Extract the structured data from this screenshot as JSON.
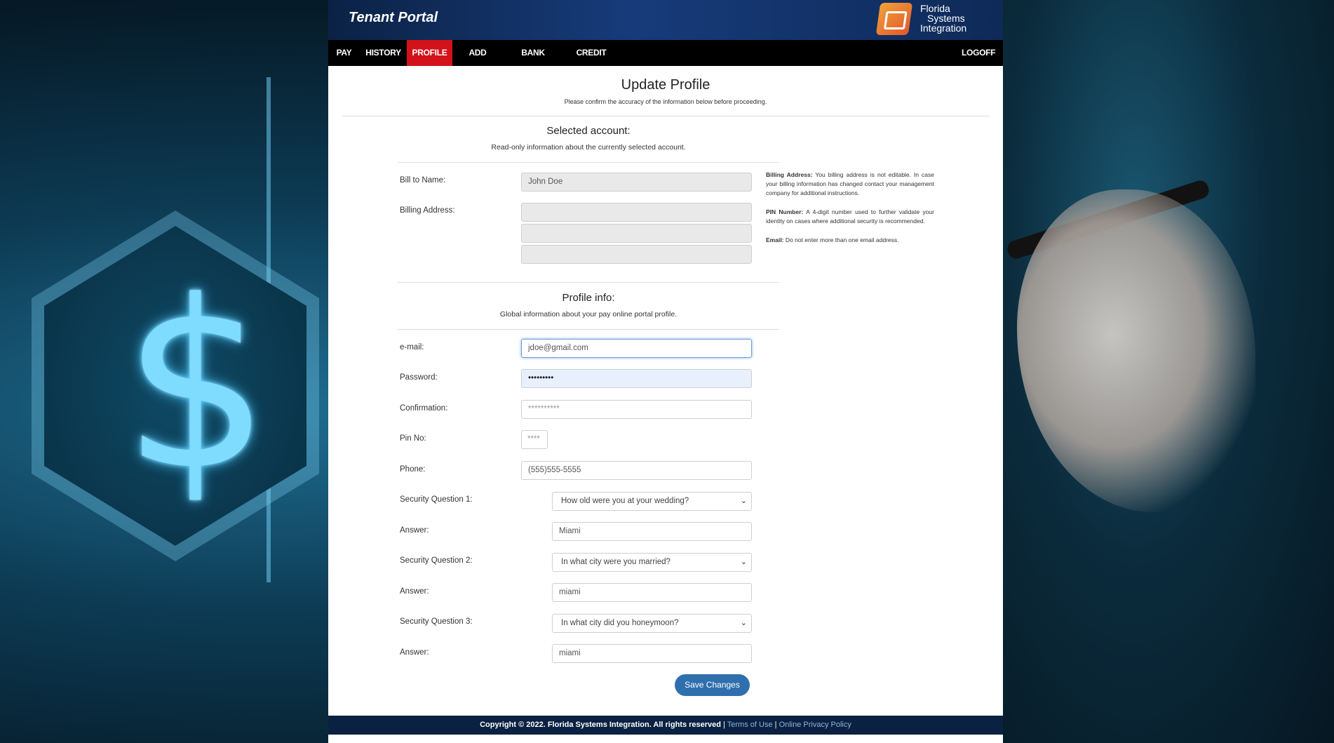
{
  "app": {
    "title": "Tenant Portal"
  },
  "logo": {
    "line1": "Florida",
    "line2": "Systems",
    "line3": "Integration"
  },
  "nav": {
    "items": [
      {
        "label": "PAY",
        "active": false
      },
      {
        "label": "HISTORY",
        "active": false
      },
      {
        "label": "PROFILE",
        "active": true
      },
      {
        "label": "ADD ACCOUNT",
        "active": false
      },
      {
        "label": "BANK ACCOUNTS",
        "active": false
      },
      {
        "label": "CREDIT CARDS",
        "active": false
      }
    ],
    "logoff": "LOGOFF"
  },
  "page": {
    "title": "Update Profile",
    "subtitle": "Please confirm the accuracy of the information below before proceeding."
  },
  "selected_account": {
    "title": "Selected account:",
    "subtitle": "Read-only information about the currently selected account.",
    "bill_to_label": "Bill to Name:",
    "bill_to_value": "John Doe",
    "billing_address_label": "Billing Address:",
    "address_line1": "",
    "address_line2": "",
    "address_line3": ""
  },
  "profile": {
    "title": "Profile info:",
    "subtitle": "Global information about your pay online portal profile.",
    "email_label": "e-mail:",
    "email_value": "jdoe@gmail.com",
    "password_label": "Password:",
    "password_value": "•••••••••",
    "confirmation_label": "Confirmation:",
    "confirmation_placeholder": "**********",
    "pin_label": "Pin No:",
    "pin_placeholder": "****",
    "phone_label": "Phone:",
    "phone_value": "(555)555-5555",
    "sq1_label": "Security Question 1:",
    "sq1_value": "How old were you at your wedding?",
    "answer1_label": "Answer:",
    "answer1_value": "Miami",
    "sq2_label": "Security Question 2:",
    "sq2_value": "In what city were you married?",
    "answer2_label": "Answer:",
    "answer2_value": "miami",
    "sq3_label": "Security Question 3:",
    "sq3_value": "In what city did you honeymoon?",
    "answer3_label": "Answer:",
    "answer3_value": "miami",
    "save_label": "Save Changes"
  },
  "help": {
    "billing_title": "Billing Address:",
    "billing_text": "You billing address is not editable. In case your billing information has changed contact your management company for additional instructions.",
    "pin_title": "PIN Number:",
    "pin_text": "A 4-digit number used to further validate your identity on cases where additional security is recommended.",
    "email_title": "Email:",
    "email_text": "Do not enter more than one email address."
  },
  "footer": {
    "copyright": "Copyright © 2022. Florida Systems Integration. All rights reserved",
    "sep": "|",
    "terms": "Terms of Use",
    "privacy": "Online Privacy Policy"
  },
  "colors": {
    "nav_active": "#d3121a",
    "header_blue": "#173b7a",
    "button_blue": "#2f6fad",
    "footer_blue": "#0b2142"
  }
}
